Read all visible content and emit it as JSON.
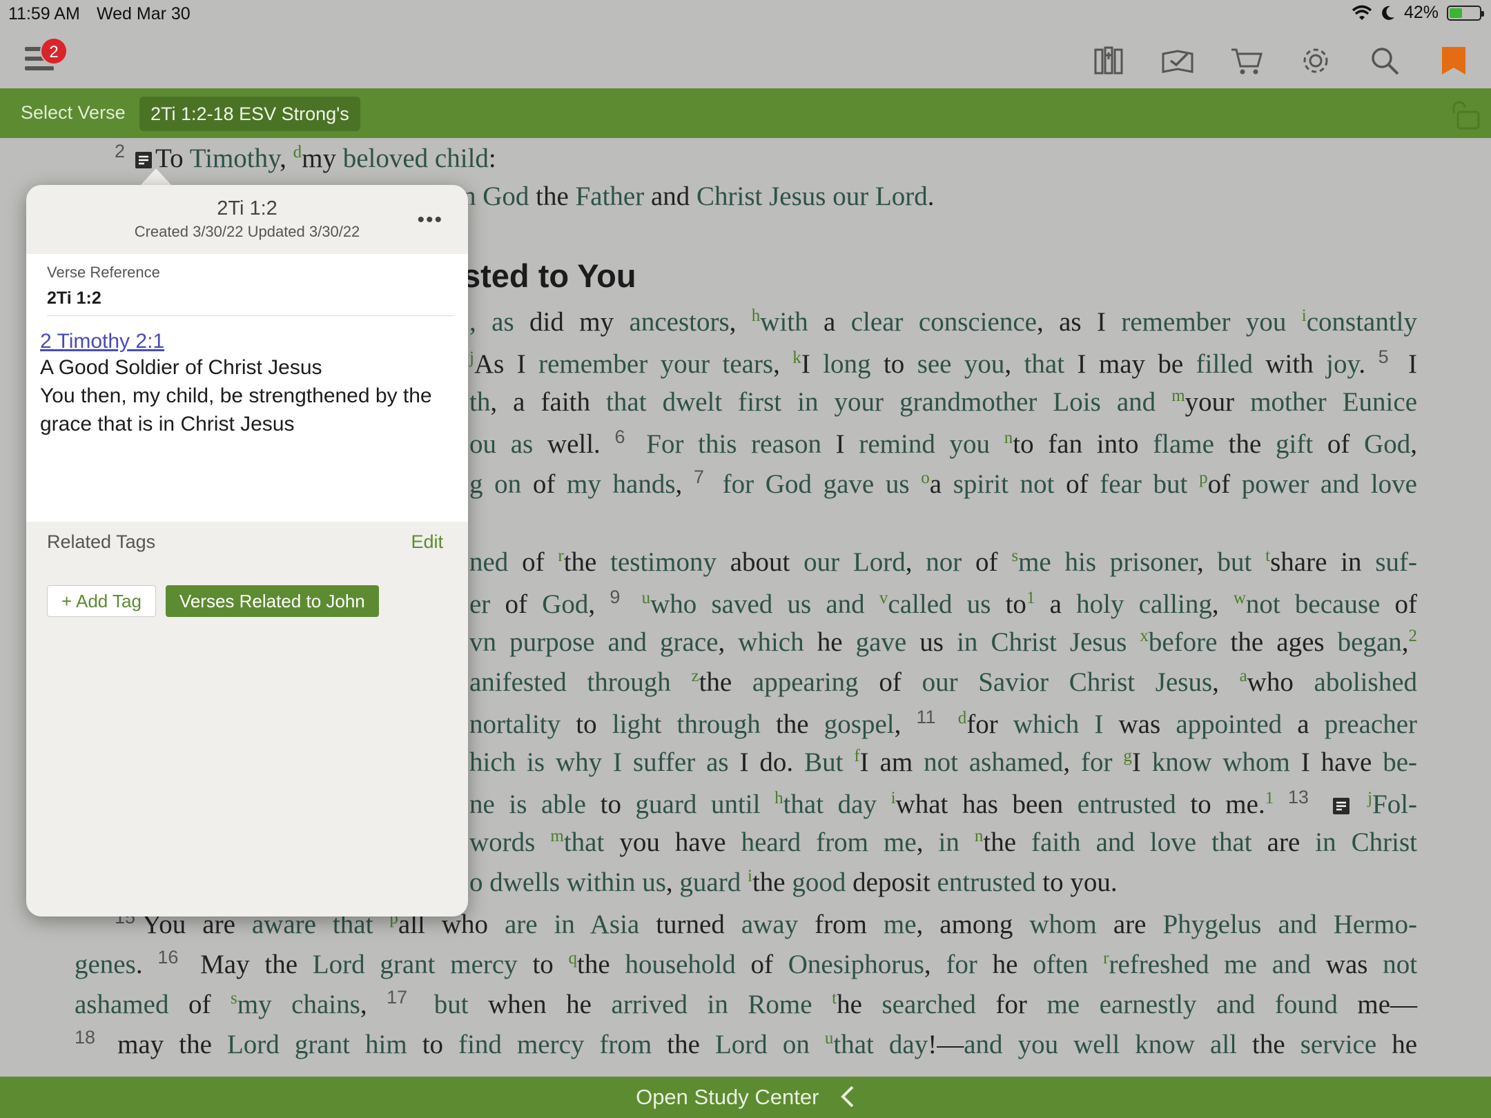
{
  "status_bar": {
    "time": "11:59 AM",
    "date": "Wed Mar 30",
    "battery_percent": "42%",
    "battery_level": 0.42
  },
  "toolbar": {
    "menu_badge": "2",
    "icons": [
      "library-icon",
      "reading-plan-icon",
      "cart-icon",
      "settings-icon",
      "search-icon",
      "bookmark-icon"
    ]
  },
  "reference_bar": {
    "select_label": "Select Verse",
    "current_reference": "2Ti 1:2-18 ESV Strong's"
  },
  "bible_text": {
    "heading": "sted to You"
  },
  "bottom_bar": {
    "label": "Open Study Center"
  },
  "note_popup": {
    "title": "2Ti 1:2",
    "dates": "Created 3/30/22 Updated 3/30/22",
    "verse_reference_label": "Verse Reference",
    "verse_reference_value": "2Ti 1:2",
    "link_text": "2 Timothy 2:1",
    "note_line1": "A Good Soldier of Christ Jesus",
    "note_line2": "You then, my child, be strengthened by the",
    "note_line3": "grace that is in Christ Jesus",
    "related_tags_label": "Related Tags",
    "edit_label": "Edit",
    "add_tag_label": "+ Add Tag",
    "tags": [
      "Verses Related to John"
    ]
  },
  "colors": {
    "green_bar": "#5d8b31",
    "badge_red": "#d9252a",
    "bookmark_orange": "#e46c12",
    "link_purple": "#4a4bb4",
    "word_link": "#2d5248"
  }
}
